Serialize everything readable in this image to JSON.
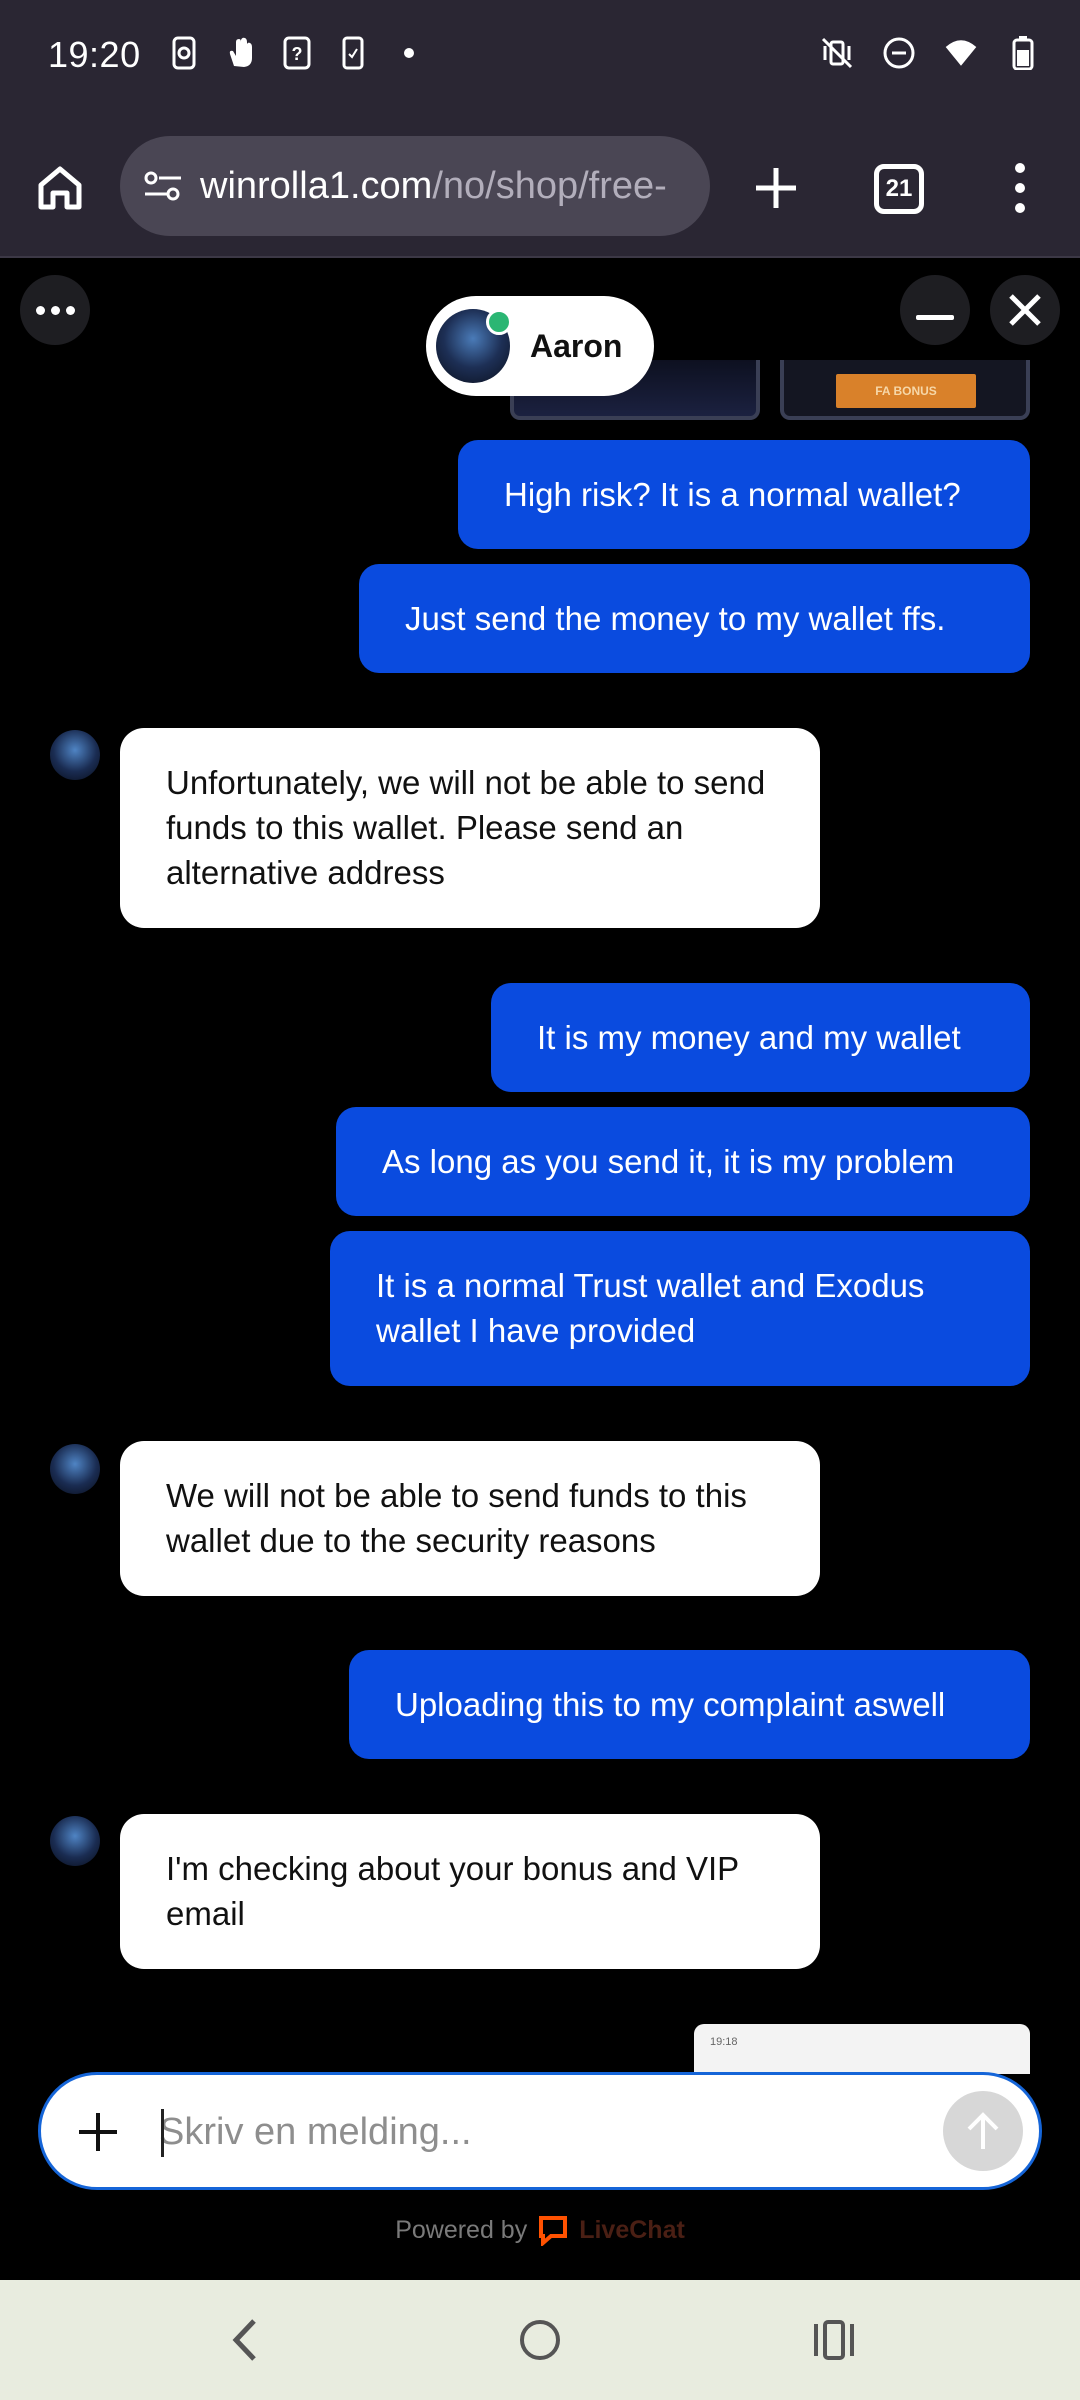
{
  "status_bar": {
    "time": "19:20",
    "left_icons": [
      "screen-record-icon",
      "hand-icon",
      "help-icon",
      "phone-card-icon",
      "dot-icon"
    ],
    "right_icons": [
      "vibrate-off-icon",
      "dnd-icon",
      "wifi-icon",
      "battery-icon"
    ]
  },
  "browser": {
    "url_host": "winrolla1.com",
    "url_path": "/no/shop/free-",
    "tab_count": "21"
  },
  "chat": {
    "agent_name": "Aaron",
    "agent_status_color": "#2bb673",
    "promo_badge": "FA BONUS",
    "messages": [
      {
        "from": "user",
        "text": "High risk? It is a normal wallet?"
      },
      {
        "from": "user",
        "text": "Just send the money to my wallet ffs."
      },
      {
        "from": "agent",
        "text": "Unfortunately, we will not be able to send funds to this wallet. Please send an alternative address"
      },
      {
        "from": "user",
        "text": "It is my money and my wallet"
      },
      {
        "from": "user",
        "text": "As long as you send it, it is my problem"
      },
      {
        "from": "user",
        "text": "It is a normal Trust wallet and Exodus wallet I have provided"
      },
      {
        "from": "agent",
        "text": "We will not be able to send funds to this wallet due to the security reasons"
      },
      {
        "from": "user",
        "text": "Uploading this to my complaint aswell"
      },
      {
        "from": "agent",
        "text": "I'm checking about your bonus and VIP email"
      }
    ],
    "thumbnail_time": "19:18",
    "input_placeholder": "Skriv en melding...",
    "powered_by": "Powered by",
    "powered_brand": "LiveChat",
    "user_bubble_color": "#0a4bdf",
    "agent_bubble_color": "#ffffff"
  }
}
